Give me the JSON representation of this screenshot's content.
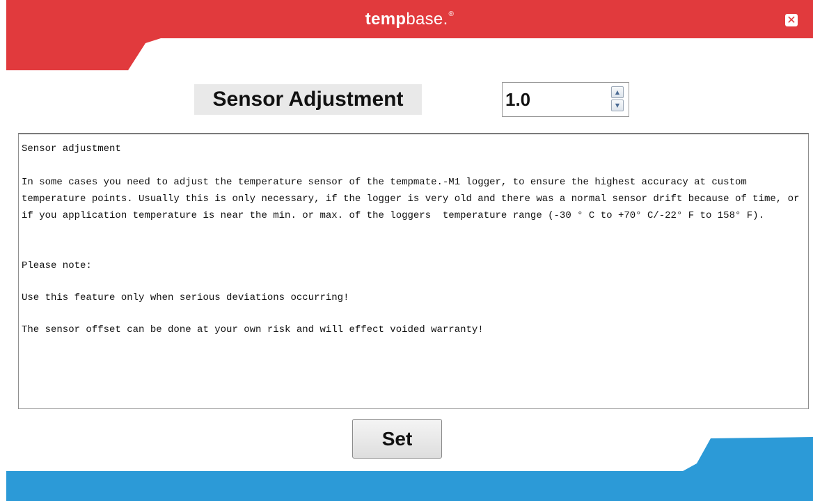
{
  "window": {
    "title_bold": "temp",
    "title_rest": "base.",
    "title_mark": "®",
    "close_icon": "close-icon",
    "colors": {
      "header": "#e13a3d",
      "footer": "#2c9ad7"
    }
  },
  "adjustment": {
    "label": "Sensor Adjustment",
    "value": "1.0"
  },
  "description": {
    "heading": "Sensor adjustment",
    "paragraph": "In some cases you need to adjust the temperature sensor of the tempmate.-M1 logger, to ensure the highest accuracy at custom temperature points. Usually this is only necessary, if the logger is very old and there was a normal sensor drift because of time, or if you application temperature is near the min. or max. of the loggers  temperature range (-30 ° C to +70° C/-22° F to 158° F).",
    "note_label": "Please note:",
    "note_1": "Use this feature only when serious deviations occurring!",
    "note_2": "The sensor offset can be done at your own risk and will effect voided warranty!"
  },
  "actions": {
    "set_label": "Set"
  }
}
